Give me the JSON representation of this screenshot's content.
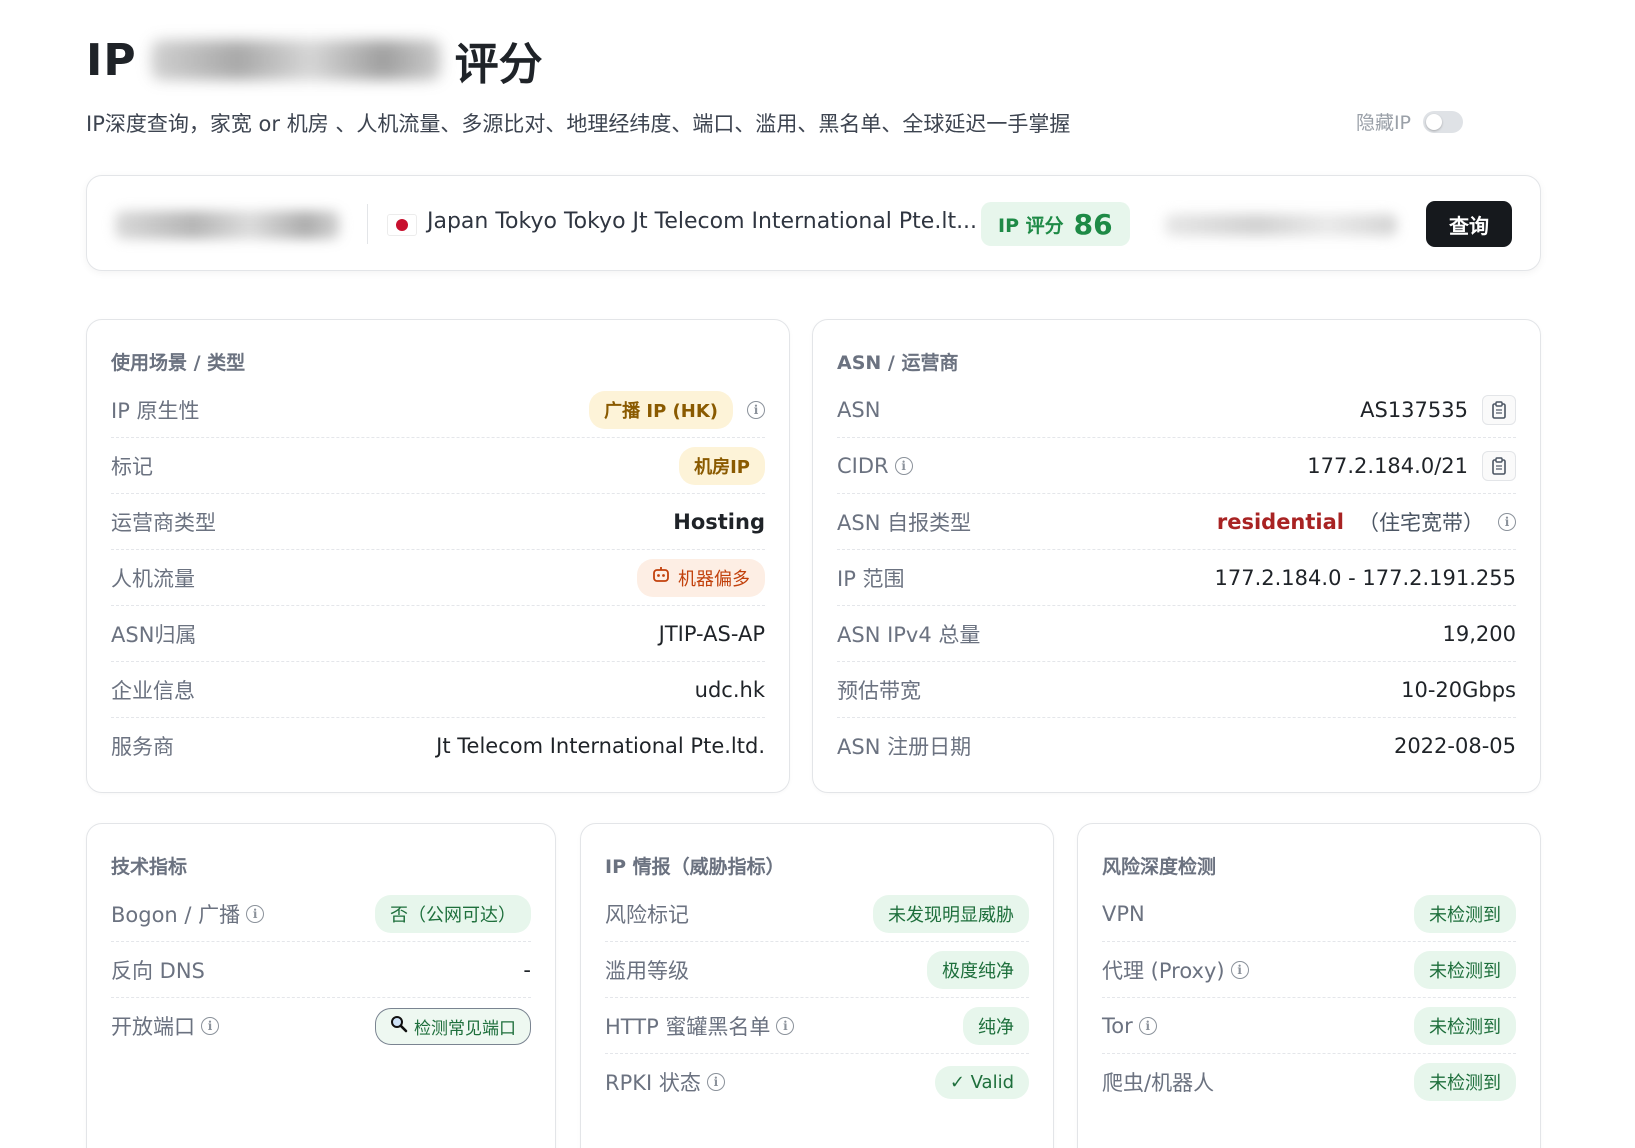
{
  "header": {
    "title_prefix": "IP",
    "title_suffix": "评分",
    "subtitle": "IP深度查询，家宽 or 机房 、人机流量、多源比对、地理经纬度、端口、滥用、黑名单、全球延迟一手掌握",
    "hide_ip_label": "隐藏IP",
    "hide_ip_on": false
  },
  "search": {
    "location": "Japan Tokyo Tokyo Jt Telecom International Pte.lt...",
    "score_label": "IP 评分",
    "score_value": "86",
    "query_button": "查询",
    "score_color": "#1e8a46"
  },
  "usage": {
    "title": "使用场景 / 类型",
    "rows": [
      {
        "label": "IP 原生性",
        "value": "广播 IP (HK)"
      },
      {
        "label": "标记",
        "value": "机房IP"
      },
      {
        "label": "运营商类型",
        "value": "Hosting"
      },
      {
        "label": "人机流量",
        "value": "机器偏多"
      },
      {
        "label": "ASN归属",
        "value": "JTIP-AS-AP"
      },
      {
        "label": "企业信息",
        "value": "udc.hk"
      },
      {
        "label": "服务商",
        "value": "Jt Telecom International Pte.ltd."
      }
    ]
  },
  "asn": {
    "title": "ASN / 运营商",
    "rows": [
      {
        "label": "ASN",
        "value": "AS137535"
      },
      {
        "label": "CIDR",
        "value": "177.2.184.0/21"
      },
      {
        "label": "ASN 自报类型",
        "value": "residential",
        "value_note": "（住宅宽带）"
      },
      {
        "label": "IP 范围",
        "value": "177.2.184.0 - 177.2.191.255"
      },
      {
        "label": "ASN IPv4 总量",
        "value": "19,200"
      },
      {
        "label": "预估带宽",
        "value": "10-20Gbps"
      },
      {
        "label": "ASN 注册日期",
        "value": "2022-08-05"
      }
    ]
  },
  "tech": {
    "title": "技术指标",
    "rows": [
      {
        "label": "Bogon / 广播",
        "value": "否（公网可达）"
      },
      {
        "label": "反向 DNS",
        "value": "-"
      },
      {
        "label": "开放端口",
        "value": "检测常见端口"
      }
    ]
  },
  "intel": {
    "title": "IP 情报（威胁指标）",
    "rows": [
      {
        "label": "风险标记",
        "value": "未发现明显威胁"
      },
      {
        "label": "滥用等级",
        "value": "极度纯净"
      },
      {
        "label": "HTTP 蜜罐黑名单",
        "value": "纯净"
      },
      {
        "label": "RPKI 状态",
        "value": "✓ Valid"
      }
    ]
  },
  "risk": {
    "title": "风险深度检测",
    "rows": [
      {
        "label": "VPN",
        "value": "未检测到"
      },
      {
        "label": "代理 (Proxy)",
        "value": "未检测到"
      },
      {
        "label": "Tor",
        "value": "未检测到"
      },
      {
        "label": "爬虫/机器人",
        "value": "未检测到"
      }
    ]
  }
}
